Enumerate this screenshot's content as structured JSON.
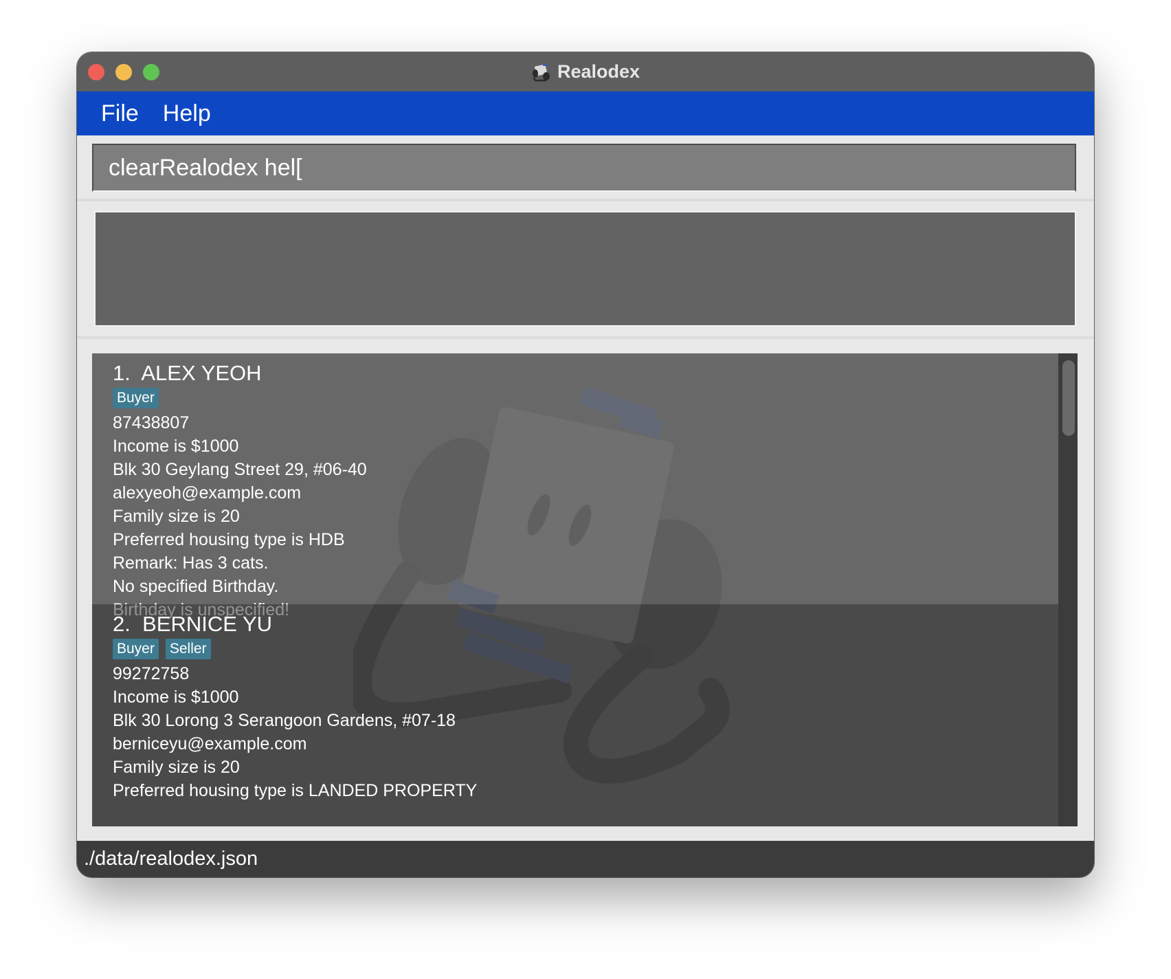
{
  "window": {
    "title": "Realodex"
  },
  "menu": {
    "file_label": "File",
    "help_label": "Help"
  },
  "command": {
    "value": "clearRealodex hel["
  },
  "result": {
    "text": ""
  },
  "persons": [
    {
      "index": "1.",
      "name": "ALEX YEOH",
      "tags": [
        "Buyer"
      ],
      "phone": "87438807",
      "income": "Income is $1000",
      "address": "Blk 30 Geylang Street 29, #06-40",
      "email": "alexyeoh@example.com",
      "family": "Family size is 20",
      "housing": "Preferred housing type is HDB",
      "remark": "Remark: Has 3 cats.",
      "birthday": "No specified Birthday.",
      "birthday_note": "Birthday is unspecified!"
    },
    {
      "index": "2.",
      "name": "BERNICE YU",
      "tags": [
        "Buyer",
        "Seller"
      ],
      "phone": "99272758",
      "income": "Income is $1000",
      "address": "Blk 30 Lorong 3 Serangoon Gardens, #07-18",
      "email": "berniceyu@example.com",
      "family": "Family size is 20",
      "housing": "Preferred housing type is LANDED PROPERTY"
    }
  ],
  "status": {
    "path": "./data/realodex.json"
  },
  "colors": {
    "menubar": "#0d47c4",
    "tag": "#3e7b91",
    "titlebar": "#5f5e5e"
  }
}
